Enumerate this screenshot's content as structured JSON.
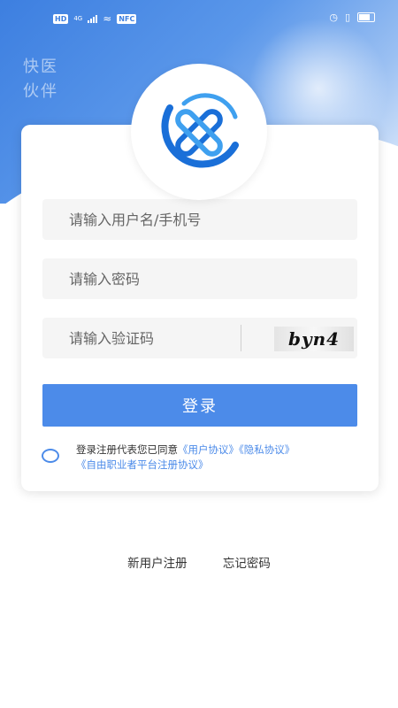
{
  "status_bar": {
    "left_badge": "HD",
    "network": "4G",
    "extra_badge": "NFC"
  },
  "brand": {
    "line1": "快医",
    "line2": "伙伴",
    "logo_colors": {
      "primary": "#1a6fd8",
      "light": "#3fa0ef"
    }
  },
  "form": {
    "username_placeholder": "请输入用户名/手机号",
    "password_placeholder": "请输入密码",
    "captcha_placeholder": "请输入验证码",
    "captcha_text": "byn4",
    "login_label": "登录"
  },
  "agreement": {
    "prefix": "登录注册代表您已同意",
    "user_agreement": "《用户协议》",
    "privacy": "《隐私协议》",
    "freelancer": "《自由职业者平台注册协议》"
  },
  "footer": {
    "register": "新用户注册",
    "forgot": "忘记密码"
  },
  "colors": {
    "accent": "#4c8be9",
    "hero": "#3d7fe0"
  }
}
